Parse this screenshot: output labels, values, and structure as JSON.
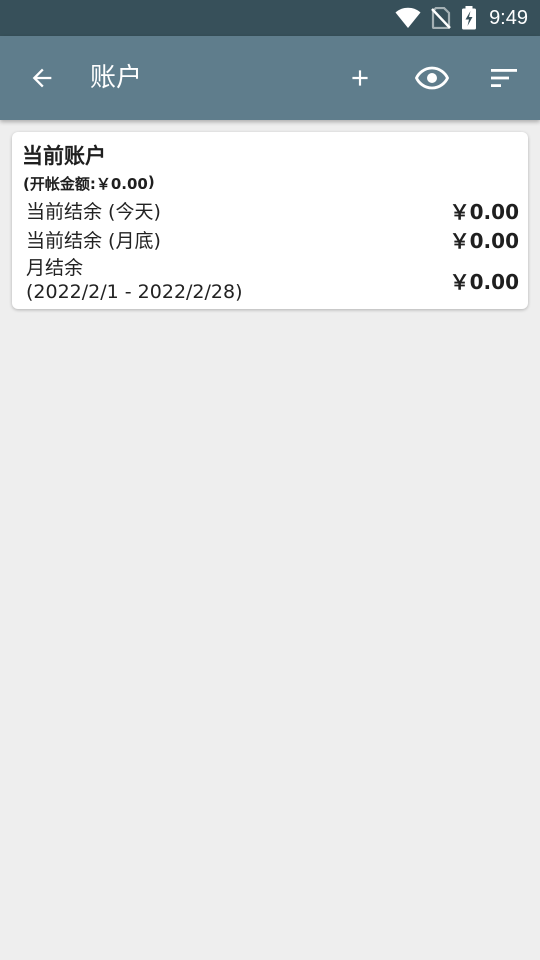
{
  "status_bar": {
    "time": "9:49",
    "icons": [
      "wifi-icon",
      "no-sim-icon",
      "battery-charging-icon"
    ]
  },
  "app_bar": {
    "title": "账户",
    "icons": [
      "arrow-back-icon",
      "plus-icon",
      "eye-icon",
      "sort-icon"
    ]
  },
  "account_card": {
    "title": "当前账户",
    "opening_balance_label": "(开帐金额: ",
    "opening_balance_value": "￥0.00",
    "opening_balance_suffix": ")",
    "rows": [
      {
        "label": "当前结余 (今天)",
        "amount": "￥0.00"
      },
      {
        "label": "当前结余 (月底)",
        "amount": "￥0.00"
      },
      {
        "label": "月结余",
        "sublabel": "(2022/2/1 - 2022/2/28)",
        "amount": "￥0.00"
      }
    ]
  },
  "colors": {
    "status_bar": "#37505a",
    "app_bar": "#5f7d8c",
    "background": "#eeeeee",
    "card": "#ffffff"
  }
}
